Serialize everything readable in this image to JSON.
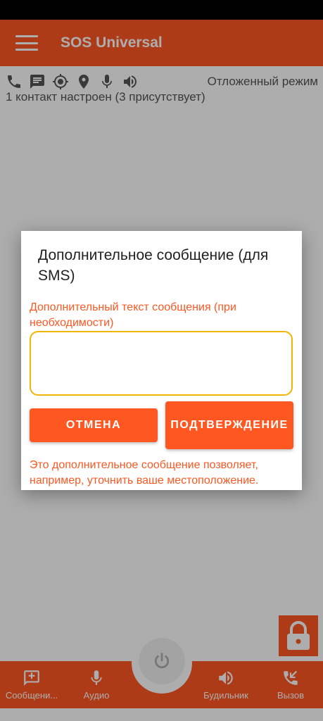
{
  "app": {
    "title": "SOS Universal",
    "delayed_mode": "Отложенный режим",
    "contacts_info": "1 контакт настроен (3 присутствует)",
    "feature_icons": [
      "phone-icon",
      "message-icon",
      "gps-icon",
      "location-pin-icon",
      "microphone-icon",
      "speaker-icon"
    ]
  },
  "bottom_nav": {
    "items": [
      {
        "label": "Сообщени...",
        "icon": "add-message-icon"
      },
      {
        "label": "Аудио",
        "icon": "microphone-icon"
      },
      {
        "label": "Будильник",
        "icon": "speaker-icon"
      },
      {
        "label": "Вызов",
        "icon": "call-icon"
      }
    ],
    "center_icon": "power-icon"
  },
  "dialog": {
    "title": "Дополнительное сообщение (для SMS)",
    "field_label": "Дополнительный текст сообщения (при необходимости)",
    "input_value": "",
    "cancel_label": "ОТМЕНА",
    "confirm_label": "ПОДТВЕРЖДЕНИЕ",
    "hint": "Это дополнительное сообщение позволяет, например, уточнить ваше местоположение."
  },
  "colors": {
    "accent": "#ff5722",
    "input_border": "#f2b600",
    "text_secondary": "#555555"
  }
}
